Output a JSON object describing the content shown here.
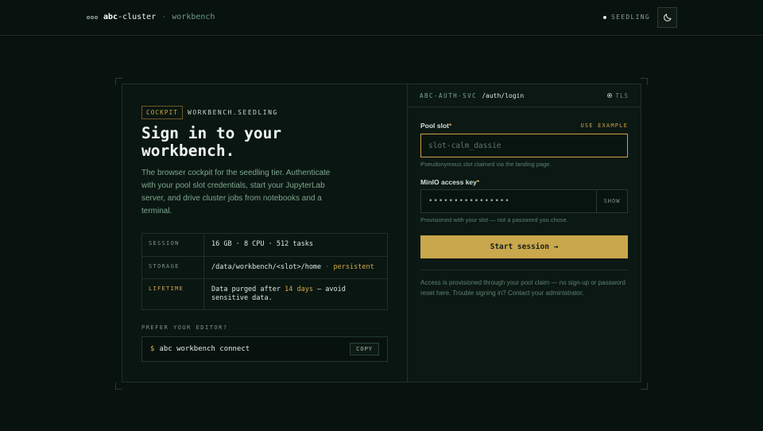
{
  "header": {
    "brand_bold": "abc",
    "brand_rest": "-cluster",
    "separator": "·",
    "sub": "workbench",
    "tier_label": "SEEDLING",
    "theme_icon": "moon-icon"
  },
  "left": {
    "tag": "COCKPIT",
    "eyebrow": "WORKBENCH.SEEDLING",
    "title": "Sign in to your workbench.",
    "description": "The browser cockpit for the seedling tier. Authenticate with your pool slot credentials, start your JupyterLab server, and drive cluster jobs from notebooks and a terminal.",
    "specs": [
      {
        "key": "SESSION",
        "value": "16 GB · 8 CPU · 512 tasks"
      },
      {
        "key": "STORAGE",
        "value": "/data/workbench/<slot>/home",
        "sep": " · ",
        "extra": "persistent"
      },
      {
        "key": "LIFETIME",
        "before": "Data purged after ",
        "highlight": "14 days",
        "after": " — avoid sensitive data."
      }
    ],
    "editor_label": "PREFER YOUR EDITOR?",
    "command_prompt": "$",
    "command": "abc workbench connect",
    "copy_label": "COPY"
  },
  "right": {
    "service": "ABC-AUTH-SVC",
    "path": "/auth/login",
    "tls_label": "TLS",
    "pool_slot_label": "Pool slot",
    "required_mark": "*",
    "use_example": "USE EXAMPLE",
    "pool_slot_placeholder": "slot-calm_dassie",
    "pool_slot_value": "",
    "pool_slot_hint": "Pseudonymous slot claimed via the landing page.",
    "key_label": "MinIO access key",
    "key_value": "••••••••••••••••",
    "show_label": "SHOW",
    "key_hint": "Provisioned with your slot — not a password you chose.",
    "submit_label": "Start session →",
    "footnote": "Access is provisioned through your pool claim — no sign-up or password reset here. Trouble signing in? Contact your administrator."
  },
  "colors": {
    "background": "#08120e",
    "accent": "#c9a74c",
    "muted_text": "#7ea790"
  }
}
